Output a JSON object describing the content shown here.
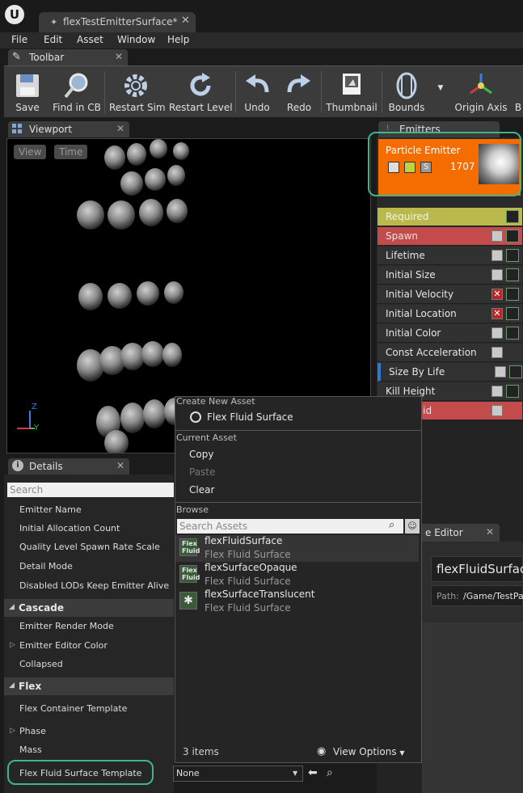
{
  "window": {
    "tab_title": "flexTestEmitterSurface*"
  },
  "menu": [
    "File",
    "Edit",
    "Asset",
    "Window",
    "Help"
  ],
  "toolbar": {
    "tab_label": "Toolbar",
    "buttons": [
      "Save",
      "Find in CB",
      "Restart Sim",
      "Restart Level",
      "Undo",
      "Redo",
      "Thumbnail",
      "Bounds",
      "Origin Axis",
      "B"
    ]
  },
  "viewport": {
    "tab_label": "Viewport",
    "view_button": "View",
    "time_button": "Time",
    "axis_z": "Z",
    "axis_y": "Y"
  },
  "emitters": {
    "tab_label": "Emitters",
    "emitter_name": "Particle Emitter",
    "particle_count": "1707",
    "solo_label": "S",
    "modules": [
      {
        "label": "Required",
        "state": "required"
      },
      {
        "label": "Spawn",
        "state": "spawn"
      },
      {
        "label": "Lifetime",
        "state": "normal"
      },
      {
        "label": "Initial Size",
        "state": "normal"
      },
      {
        "label": "Initial Velocity",
        "state": "disabled"
      },
      {
        "label": "Initial Location",
        "state": "disabled"
      },
      {
        "label": "Initial Color",
        "state": "normal"
      },
      {
        "label": "Const Acceleration",
        "state": "nocurve"
      },
      {
        "label": "Size By Life",
        "state": "normal"
      },
      {
        "label": "Kill Height",
        "state": "normal"
      },
      {
        "label": "Flex Fluid",
        "state": "flex"
      }
    ]
  },
  "details": {
    "tab_label": "Details",
    "search_placeholder": "Search",
    "emitter_props": [
      "Emitter Name",
      "Initial Allocation Count",
      "Quality Level Spawn Rate Scale",
      "Detail Mode",
      "Disabled LODs Keep Emitter Alive"
    ],
    "cascade": {
      "label": "Cascade",
      "props": [
        "Emitter Render Mode",
        "Emitter Editor Color",
        "Collapsed"
      ]
    },
    "flex": {
      "label": "Flex",
      "props": [
        "Flex Container Template",
        "Phase",
        "Mass",
        "Flex Fluid Surface Template"
      ]
    },
    "combo_value": "None"
  },
  "material_editor": {
    "tab_label": "e Editor",
    "title": "flexFluidSurfac",
    "path_label": "Path:",
    "path_value": "/Game/TestPa"
  },
  "dropdown": {
    "create_header": "Create New Asset",
    "create_item": "Flex Fluid Surface",
    "current_header": "Current Asset",
    "copy": "Copy",
    "paste": "Paste",
    "clear": "Clear",
    "browse_header": "Browse",
    "search_placeholder": "Search Assets",
    "assets": [
      {
        "name": "flexFluidSurface",
        "type": "Flex Fluid Surface",
        "thumb": "Flex Fluid"
      },
      {
        "name": "flexSurfaceOpaque",
        "type": "Flex Fluid Surface",
        "thumb": "Flex Fluid"
      },
      {
        "name": "flexSurfaceTranslucent",
        "type": "Flex Fluid Surface",
        "thumb": ""
      }
    ],
    "count": "3 items",
    "view_options": "View Options"
  }
}
